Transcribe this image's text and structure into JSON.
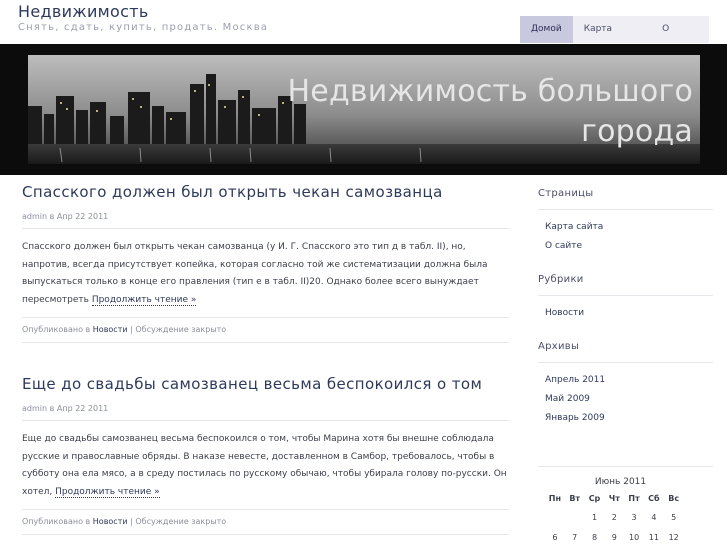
{
  "site": {
    "title": "Недвижимость",
    "description": "Снять, сдать, купить, продать. Москва"
  },
  "nav": {
    "items": [
      {
        "label": "Домой",
        "active": true
      },
      {
        "label": "Карта сайта",
        "active": false
      },
      {
        "label": "О сайте",
        "active": false
      }
    ]
  },
  "banner": {
    "line1": "Недвижимость большого",
    "line2": "города"
  },
  "posts": [
    {
      "title": "Спасского должен был открыть чекан самозванца",
      "meta": "admin в Апр 22 2011",
      "body": "Спасского должен был открыть чекан самозванца (у И. Г. Спасского это тип д в табл. II), но, напротив, всегда присутствует копейка, которая согласно той же систематизации должна была выпускаться только в конце его правления (тип е в табл. II)20. Однако более всего вынуждает пересмотреть ",
      "more": "Продолжить чтение »",
      "posted_in": "Опубликовано в ",
      "category": "Новости",
      "comments": " | Обсуждение закрыто"
    },
    {
      "title": "Еще до свадьбы самозванец весьма беспокоился о том",
      "meta": "admin в Апр 22 2011",
      "body": "Еще до свадьбы самозванец весьма беспокоился о том, чтобы Марина хотя бы внешне соблюдала русские и православные обряды. В наказе невесте, доставленном в Самбор, требовалось, чтобы в субботу она ела мясо, а в среду постилась по русскому обычаю, чтобы убирала голову по-русски. Он хотел, ",
      "more": "Продолжить чтение »",
      "posted_in": "Опубликовано в ",
      "category": "Новости",
      "comments": " | Обсуждение закрыто"
    }
  ],
  "sidebar": {
    "pages": {
      "title": "Страницы",
      "items": [
        "Карта сайта",
        "О сайте"
      ]
    },
    "categories": {
      "title": "Рубрики",
      "items": [
        "Новости"
      ]
    },
    "archives": {
      "title": "Архивы",
      "items": [
        "Апрель 2011",
        "Май 2009",
        "Январь 2009"
      ]
    }
  },
  "calendar": {
    "caption": "Июнь 2011",
    "days": [
      "Пн",
      "Вт",
      "Ср",
      "Чт",
      "Пт",
      "Сб",
      "Вс"
    ],
    "rows": [
      [
        "",
        "",
        "1",
        "2",
        "3",
        "4",
        "5"
      ],
      [
        "6",
        "7",
        "8",
        "9",
        "10",
        "11",
        "12"
      ]
    ]
  }
}
